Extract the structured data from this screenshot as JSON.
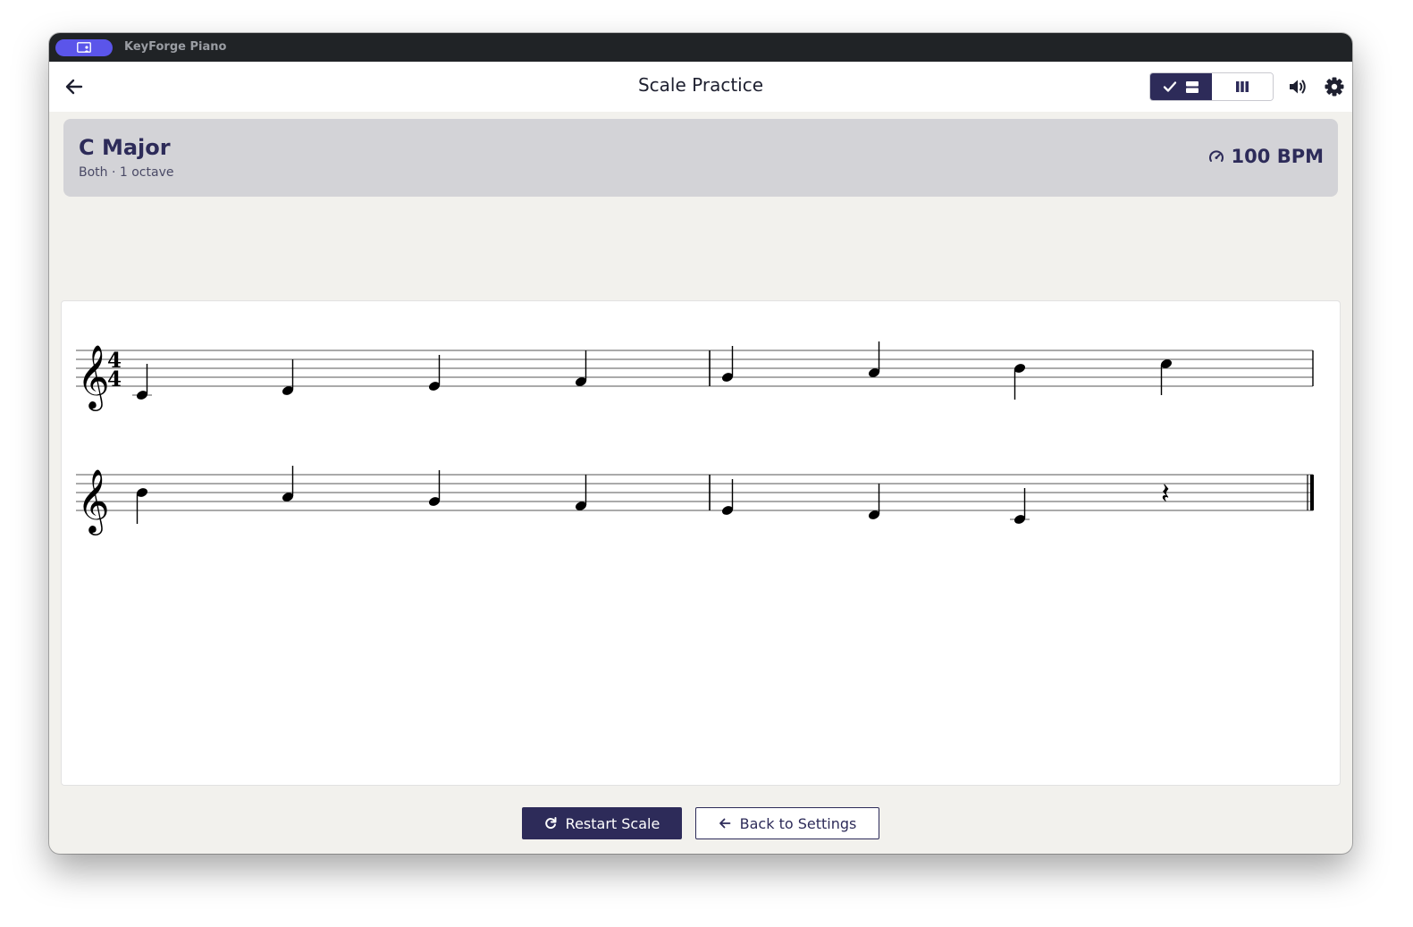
{
  "app": {
    "title": "KeyForge Piano",
    "launcher_icon": "person-screen-icon"
  },
  "header": {
    "back_icon": "arrow-left-icon",
    "title": "Scale Practice",
    "view_toggle": [
      {
        "name": "staff-view",
        "icons": [
          "check-icon",
          "stacked-view-icon"
        ],
        "active": true
      },
      {
        "name": "keyboard-view",
        "icons": [
          "piano-keys-icon"
        ],
        "active": false
      }
    ],
    "volume_icon": "speaker-icon",
    "settings_icon": "gear-icon"
  },
  "scale": {
    "name": "C Major",
    "details": "Both · 1 octave",
    "tempo": "100 BPM",
    "tempo_icon": "gauge-icon"
  },
  "sheet_music": {
    "clef": "treble",
    "time_signature": "4/4",
    "systems": [
      {
        "measures": [
          [
            "C4",
            "D4",
            "E4",
            "F4"
          ],
          [
            "G4",
            "A4",
            "B4",
            "C5"
          ]
        ],
        "end_barline": "single"
      },
      {
        "measures": [
          [
            "B4",
            "A4",
            "G4",
            "F4"
          ],
          [
            "E4",
            "D4",
            "C4",
            "rest"
          ]
        ],
        "end_barline": "final"
      }
    ]
  },
  "actions": {
    "restart_label": "Restart Scale",
    "restart_icon": "refresh-icon",
    "back_label": "Back to Settings",
    "back_icon": "arrow-left-icon"
  },
  "colors": {
    "accent": "#2d2b59",
    "launcher": "#5b55ea",
    "titlebar": "#202326",
    "page_bg": "#f2f1ed",
    "card_bg": "#d3d3d7"
  }
}
